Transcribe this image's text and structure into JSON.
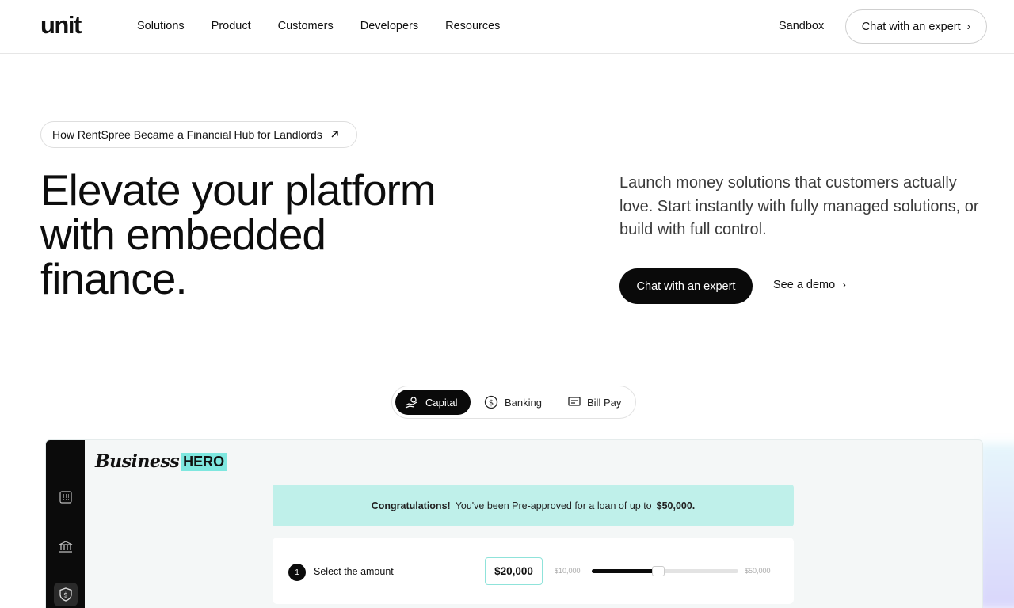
{
  "header": {
    "logo": "unit",
    "nav": [
      "Solutions",
      "Product",
      "Customers",
      "Developers",
      "Resources"
    ],
    "sandbox": "Sandbox",
    "cta": "Chat with an expert"
  },
  "story_pill": {
    "label": "How RentSpree Became a Financial Hub for Landlords"
  },
  "hero": {
    "title_line1": "Elevate your platform",
    "title_line2": "with embedded",
    "title_line3": "finance.",
    "subtitle": "Launch money solutions that customers actually love. Start instantly with fully managed solutions, or build with full control.",
    "cta": "Chat with an expert",
    "demo_link": "See a demo"
  },
  "tabs": [
    {
      "label": "Capital",
      "icon": "hand-coin-icon",
      "active": true
    },
    {
      "label": "Banking",
      "icon": "dollar-circle-icon",
      "active": false
    },
    {
      "label": "Bill Pay",
      "icon": "receipt-icon",
      "active": false
    }
  ],
  "demo": {
    "brand_script": "Business",
    "brand_badge": "HERO",
    "brand_color": "#7ee7df",
    "congrats_bold": "Congratulations!",
    "congrats_text": "You've been Pre-approved for a loan of up to",
    "congrats_amount": "$50,000.",
    "step_number": "1",
    "step_label": "Select the amount",
    "amount": "$20,000",
    "slider_min": "$10,000",
    "slider_max": "$50,000",
    "slider_fraction": 0.43
  }
}
